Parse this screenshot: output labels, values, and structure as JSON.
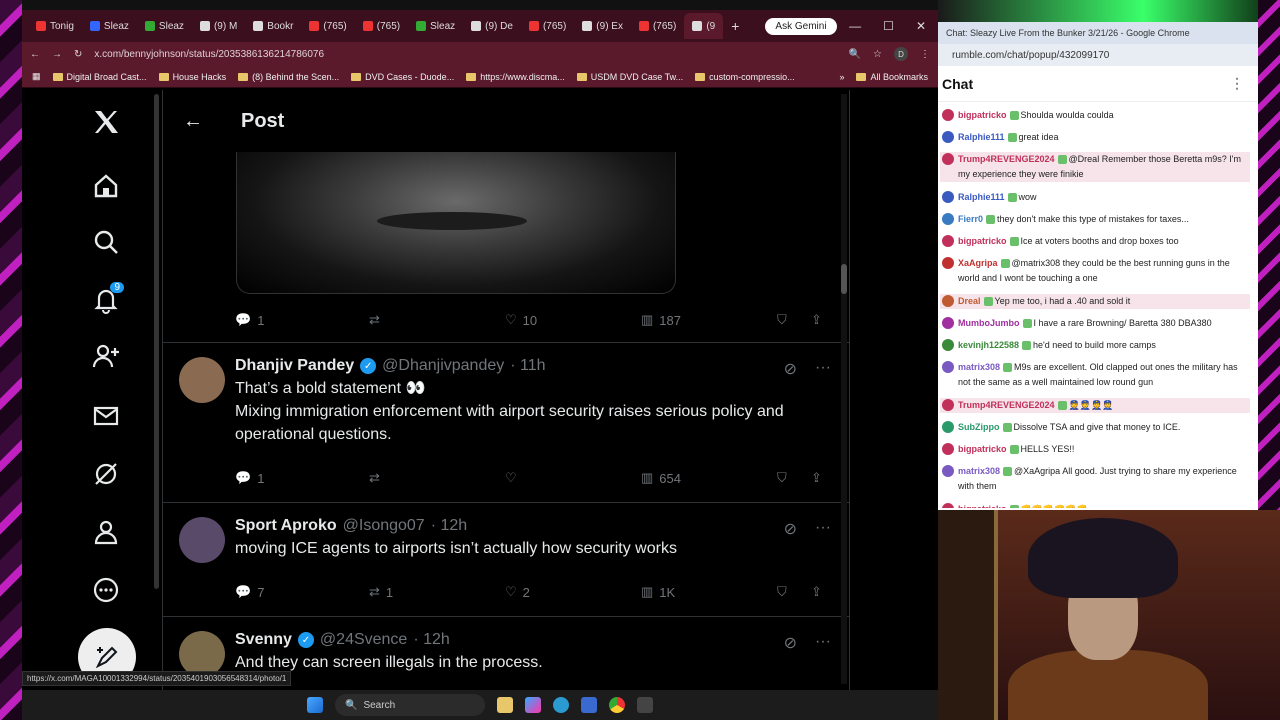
{
  "browser": {
    "tabs": [
      "Tonig",
      "Sleaz",
      "Sleaz",
      "(9) M",
      "Bookr",
      "(765)",
      "(765)",
      "Sleaz",
      "(9) De",
      "(765)",
      "(9) Ex",
      "(765)",
      "(9"
    ],
    "gemini_label": "Ask Gemini",
    "url": "x.com/bennyjohnson/status/2035386136214786076",
    "profile_initial": "D",
    "bookmarks": [
      "Digital Broad Cast...",
      "House Hacks",
      "(8) Behind the Scen...",
      "DVD Cases - Duode...",
      "https://www.discma...",
      "USDM DVD Case Tw...",
      "custom-compressio..."
    ],
    "all_bookmarks": "All Bookmarks",
    "status_url": "https://x.com/MAGA10001332994/status/2035401903056548314/photo/1"
  },
  "x": {
    "header_title": "Post",
    "notification_count": "9",
    "main_post_stats": {
      "replies": "1",
      "likes": "10",
      "views": "187"
    },
    "replies": [
      {
        "name": "Dhanjiv Pandey",
        "verified": true,
        "handle": "@Dhanjivpandey",
        "time": "· 11h",
        "lines": [
          "That’s a bold statement 👀",
          "Mixing immigration enforcement with airport security raises serious policy and operational questions."
        ],
        "reply_count": "1",
        "retweets": "",
        "likes": "",
        "views": "654",
        "avatar_color": "#8a6a50"
      },
      {
        "name": "Sport Aproko",
        "verified": false,
        "handle": "@Isongo07",
        "time": "· 12h",
        "lines": [
          "moving ICE agents to airports isn’t actually how security works"
        ],
        "reply_count": "7",
        "retweets": "1",
        "likes": "2",
        "views": "1K",
        "avatar_color": "#5a4a6a"
      },
      {
        "name": "Svenny",
        "verified": true,
        "handle": "@24Svence",
        "time": "· 12h",
        "lines": [
          "And they can screen illegals in the process."
        ],
        "reply_count": "",
        "retweets": "",
        "likes": "",
        "views": "",
        "avatar_color": "#7a6a4a"
      }
    ]
  },
  "chat": {
    "window_title": "Chat: Sleazy Live From the Bunker 3/21/26 - Google Chrome",
    "url": "rumble.com/chat/popup/432099170",
    "heading": "Chat",
    "messages": [
      {
        "user": "bigpatricko",
        "color": "#c0305a",
        "text": "Shoulda woulda coulda",
        "hl": false
      },
      {
        "user": "Ralphie111",
        "color": "#3a5ac0",
        "text": "great idea",
        "hl": false
      },
      {
        "user": "Trump4REVENGE2024",
        "color": "#c0305a",
        "text": "@Dreal Remember those Beretta m9s? I'm my experience they were finikie",
        "hl": true
      },
      {
        "user": "Ralphie111",
        "color": "#3a5ac0",
        "text": "wow",
        "hl": false
      },
      {
        "user": "Fierr0",
        "color": "#3a7ac0",
        "text": "they don't make this type of mistakes for taxes...",
        "hl": false
      },
      {
        "user": "bigpatricko",
        "color": "#c0305a",
        "text": "Ice at voters booths and drop boxes too",
        "hl": false
      },
      {
        "user": "XaAgripa",
        "color": "#c03030",
        "text": "@matrix308 they could be the best running guns in the world and I wont be touching a one",
        "hl": false
      },
      {
        "user": "Dreal",
        "color": "#c05a30",
        "text": "Yep me too, i had a .40 and sold it",
        "hl": true
      },
      {
        "user": "MumboJumbo",
        "color": "#a030a0",
        "text": "I have a rare Browning/ Baretta 380 DBA380",
        "hl": false
      },
      {
        "user": "kevinjh122588",
        "color": "#3a8a3a",
        "text": "he'd need to build more camps",
        "hl": false
      },
      {
        "user": "matrix308",
        "color": "#7a5ac0",
        "text": "M9s are excellent. Old clapped out ones the military has not the same as a well maintained low round gun",
        "hl": false
      },
      {
        "user": "Trump4REVENGE2024",
        "color": "#c0305a",
        "text": "👮👮👮👮",
        "hl": true
      },
      {
        "user": "SubZippo",
        "color": "#2a9a6a",
        "text": "Dissolve TSA and give that money to ICE.",
        "hl": false
      },
      {
        "user": "bigpatricko",
        "color": "#c0305a",
        "text": "HELLS YES!!",
        "hl": false
      },
      {
        "user": "matrix308",
        "color": "#7a5ac0",
        "text": "@XaAgripa All good. Just trying to share my experience with them",
        "hl": false
      },
      {
        "user": "bigpatricko",
        "color": "#c0305a",
        "text": "👊👊👊👊👊👊",
        "hl": false
      }
    ]
  },
  "taskbar": {
    "search_label": "Search"
  }
}
